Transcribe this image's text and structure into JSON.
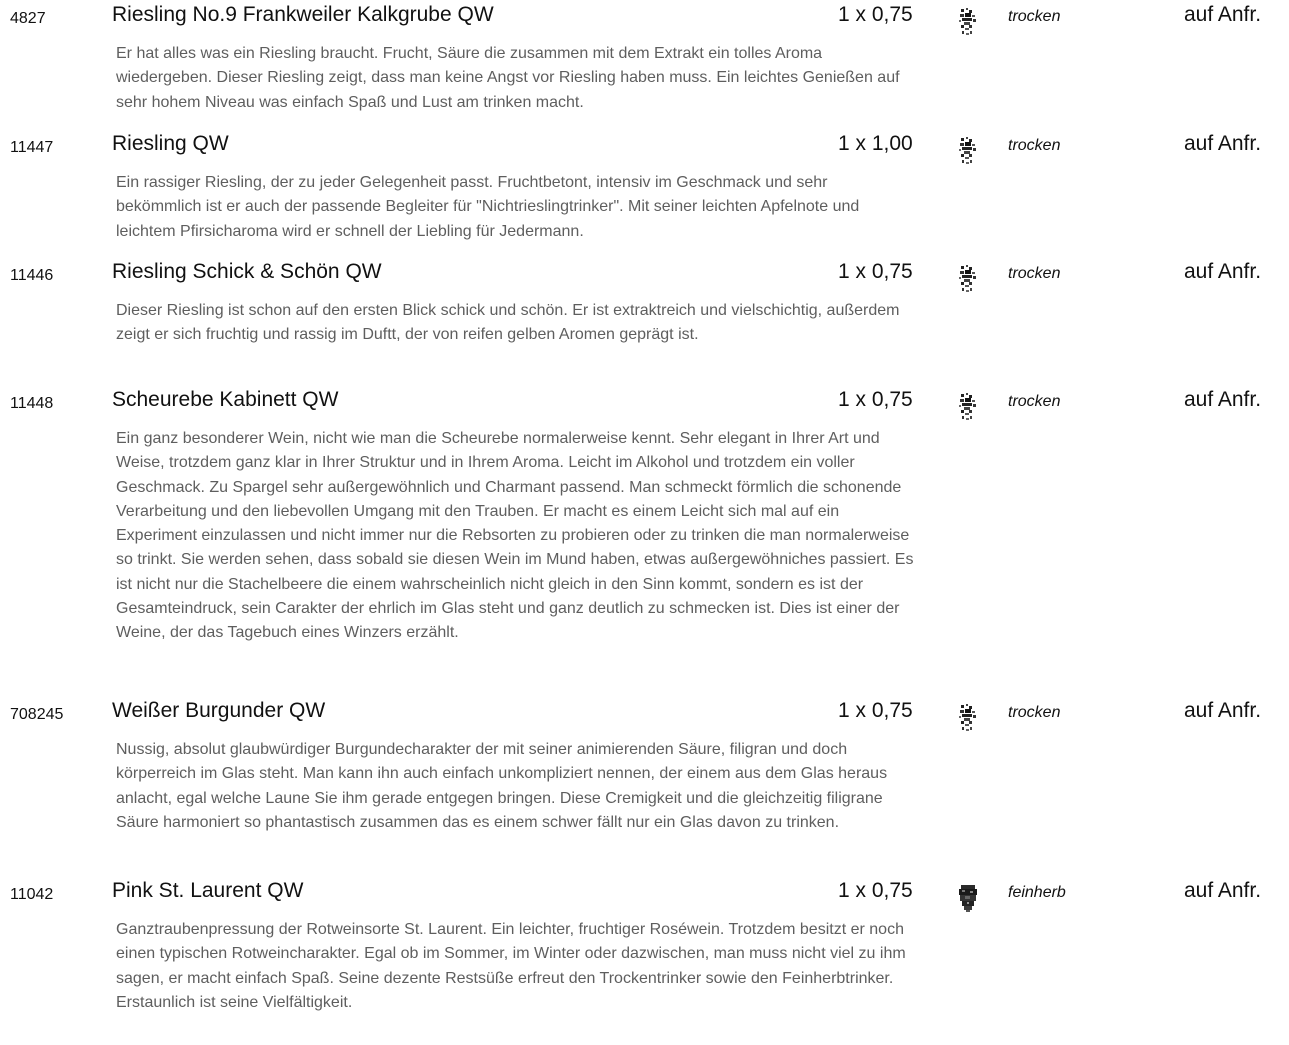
{
  "wines": [
    {
      "art_nr": "4827",
      "name": "Riesling No.9 Frankweiler Kalkgrube QW",
      "size": "1 x 0,75",
      "icon": "trocken-pictogram-icon",
      "taste": "trocken",
      "price": "auf Anfr.",
      "description": "Er hat alles was ein Riesling braucht. Frucht, Säure die zusammen mit dem Extrakt ein tolles Aroma wiedergeben. Dieser Riesling zeigt, dass man keine Angst vor Riesling haben muss. Ein leichtes Genießen auf sehr hohem Niveau was einfach Spaß und Lust am trinken macht."
    },
    {
      "art_nr": "11447",
      "name": "Riesling QW",
      "size": "1 x 1,00",
      "icon": "trocken-pictogram-icon",
      "taste": "trocken",
      "price": "auf Anfr.",
      "description": "Ein rassiger Riesling, der zu jeder Gelegenheit passt. Fruchtbetont, intensiv im Geschmack und sehr bekömmlich ist er auch der passende Begleiter für \"Nichtrieslingtrinker\". Mit seiner leichten Apfelnote und leichtem Pfirsicharoma wird er schnell der Liebling für Jedermann."
    },
    {
      "art_nr": "11446",
      "name": "Riesling Schick & Schön QW",
      "size": "1 x 0,75",
      "icon": "trocken-pictogram-icon",
      "taste": "trocken",
      "price": "auf Anfr.",
      "description": "Dieser Riesling ist schon auf den ersten Blick schick und schön. Er ist extraktreich und vielschichtig, außerdem zeigt er sich fruchtig und rassig im Duftt, der von reifen gelben Aromen geprägt ist."
    },
    {
      "art_nr": "11448",
      "name": "Scheurebe Kabinett QW",
      "size": "1 x 0,75",
      "icon": "trocken-pictogram-icon",
      "taste": "trocken",
      "price": "auf Anfr.",
      "description": "Ein ganz besonderer Wein, nicht wie man die Scheurebe normalerweise kennt. Sehr elegant in Ihrer Art und Weise, trotzdem ganz klar in Ihrer Struktur und in Ihrem Aroma. Leicht im Alkohol und trotzdem ein voller Geschmack. Zu Spargel sehr außergewöhnlich und Charmant passend. Man schmeckt förmlich die schonende Verarbeitung und den liebevollen Umgang mit den Trauben. Er macht es einem Leicht sich mal auf ein Experiment einzulassen und nicht immer nur die Rebsorten zu probieren oder zu trinken die man normalerweise so trinkt. Sie werden sehen, dass sobald sie diesen Wein im Mund haben, etwas außergewöhniches passiert. Es ist nicht nur die Stachelbeere die einem wahrscheinlich nicht gleich in den Sinn kommt, sondern es ist der Gesamteindruck, sein Carakter der ehrlich im Glas steht und ganz deutlich zu schmecken ist. Dies ist einer der Weine, der das Tagebuch eines Winzers erzählt."
    },
    {
      "art_nr": "708245",
      "name": "Weißer Burgunder QW",
      "size": "1 x 0,75",
      "icon": "trocken-pictogram-icon",
      "taste": "trocken",
      "price": "auf Anfr.",
      "description": "Nussig, absolut glaubwürdiger Burgundecharakter der mit seiner animierenden Säure, filigran und doch körperreich im Glas steht. Man kann ihn auch einfach unkompliziert nennen, der einem aus dem Glas heraus anlacht, egal welche Laune Sie ihm gerade entgegen bringen. Diese Cremigkeit und die gleichzeitig filigrane Säure harmoniert so phantastisch zusammen das es einem schwer fällt nur ein Glas davon zu trinken."
    },
    {
      "art_nr": "11042",
      "name": "Pink St. Laurent QW",
      "size": "1 x 0,75",
      "icon": "feinherb-pictogram-icon",
      "taste": "feinherb",
      "price": "auf Anfr.",
      "description": "Ganztraubenpressung der Rotweinsorte St. Laurent. Ein leichter, fruchtiger Roséwein. Trotzdem besitzt er noch einen typischen Rotweincharakter. Egal ob im Sommer, im Winter oder dazwischen, man muss nicht viel zu ihm sagen, er macht einfach Spaß. Seine dezente Restsüße erfreut den Trockentrinker sowie den Feinherbtrinker. Erstaunlich ist seine Vielfältigkeit."
    }
  ]
}
